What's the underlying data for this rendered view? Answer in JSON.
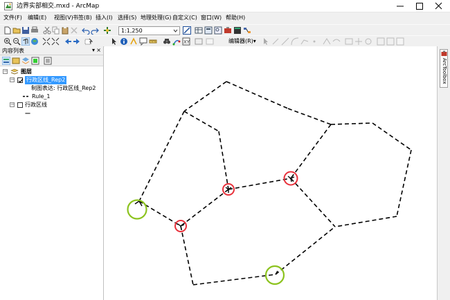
{
  "window": {
    "title": "边界实部相交.mxd - ArcMap",
    "minimize_icon": "minimize-icon",
    "maximize_icon": "maximize-icon",
    "close_icon": "close-icon"
  },
  "menu": {
    "items": [
      "文件(F)",
      "编辑(E)",
      "视图(V)",
      "书签(B)",
      "插入(I)",
      "选择(S)",
      "地理处理(G)",
      "自定义(C)",
      "窗口(W)",
      "帮助(H)"
    ]
  },
  "toolbar": {
    "scale": "1:1,250",
    "editor_label": "编辑器(R)▾"
  },
  "toc": {
    "title": "内容列表",
    "pin": "▾",
    "close": "×",
    "layers_root": "图层",
    "layer1": "行政区线_Rep2",
    "layer1_rep": "制图表达: 行政区线_Rep2",
    "layer1_rule": "Rule_1",
    "layer2": "行政区线",
    "layer2_symbol": "—"
  },
  "sidebar": {
    "arctoolbox_label": "ArcToolbox"
  },
  "colors": {
    "highlight_red": "#e8303a",
    "highlight_green": "#8cc31e",
    "selection_blue": "#3399ff"
  }
}
